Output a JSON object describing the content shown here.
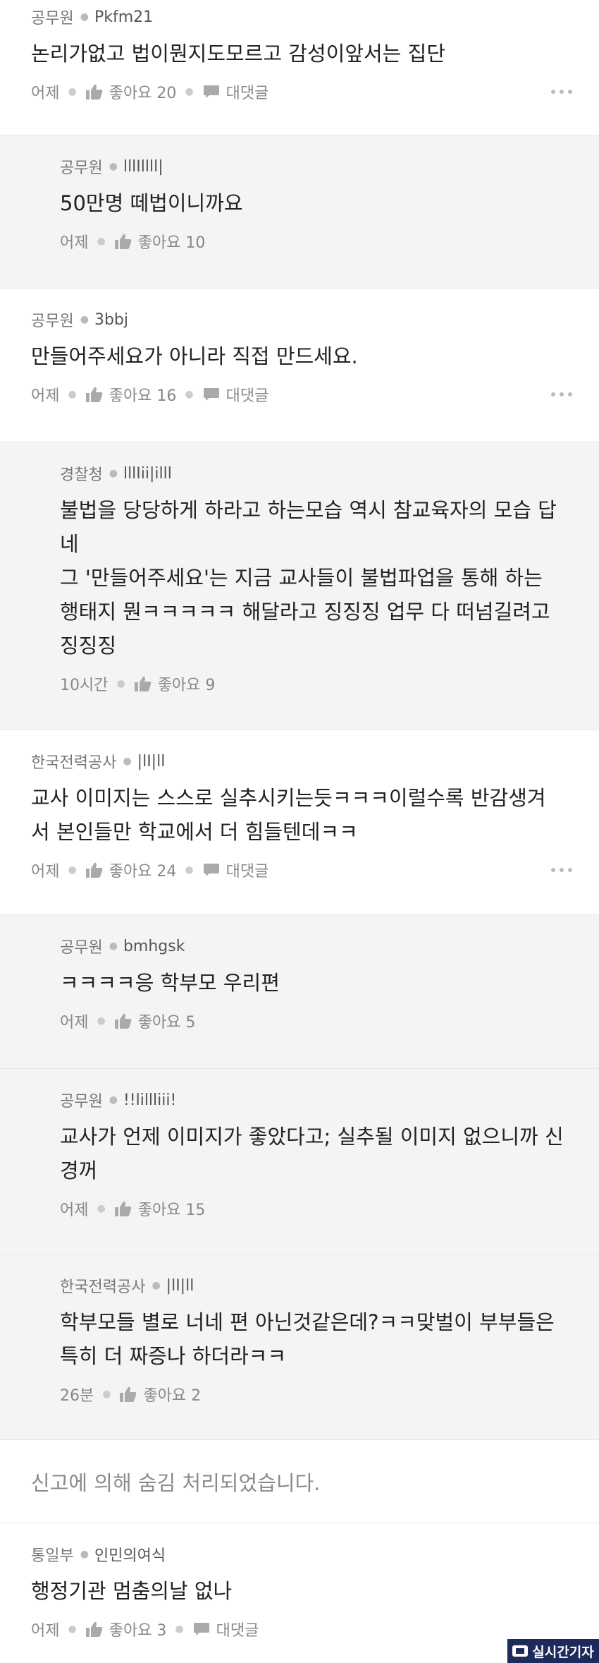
{
  "comments": [
    {
      "affiliation": "공무원",
      "user": "Pkfm21",
      "text": "논리가없고 법이뭔지도모르고 감성이앞서는 집단",
      "time": "어제",
      "likes": "좋아요 20",
      "reply_label": "대댓글"
    },
    {
      "affiliation": "공무원",
      "user": "lllIllll|",
      "text": "50만명 떼법이니까요",
      "time": "어제",
      "likes": "좋아요 10"
    },
    {
      "affiliation": "공무원",
      "user": "3bbj",
      "text": "만들어주세요가 아니라 직접 만드세요.",
      "time": "어제",
      "likes": "좋아요 16",
      "reply_label": "대댓글"
    },
    {
      "affiliation": "경찰청",
      "user": "lllIii|illl",
      "text": "불법을 당당하게 하라고 하는모습 역시 참교육자의 모습 답\n네\n그 '만들어주세요'는 지금 교사들이 불법파업을 통해 하는\n행태지 뭔ㅋㅋㅋㅋㅋ 해달라고 징징징 업무 다 떠넘길려고\n징징징",
      "time": "10시간",
      "likes": "좋아요 9"
    },
    {
      "affiliation": "한국전력공사",
      "user": "|lI|ll",
      "text": "교사 이미지는 스스로 실추시키는듯ㅋㅋㅋ이럴수록 반감생겨\n서 본인들만 학교에서 더 힘들텐데ㅋㅋ",
      "time": "어제",
      "likes": "좋아요 24",
      "reply_label": "대댓글"
    },
    {
      "affiliation": "공무원",
      "user": "bmhgsk",
      "text": "ㅋㅋㅋㅋ응 학부모 우리편",
      "time": "어제",
      "likes": "좋아요 5"
    },
    {
      "affiliation": "공무원",
      "user": "!!lillliii!",
      "text": "교사가 언제 이미지가 좋았다고; 실추될 이미지 없으니까 신\n경꺼",
      "time": "어제",
      "likes": "좋아요 15"
    },
    {
      "affiliation": "한국전력공사",
      "user": "|lI|ll",
      "text": "학부모들 별로 너네 편 아닌것같은데?ㅋㅋ맞벌이 부부들은\n특히 더 짜증나 하더라ㅋㅋ",
      "time": "26분",
      "likes": "좋아요 2"
    },
    {
      "affiliation": "통일부",
      "user": "인민의여식",
      "text": "행정기관 멈춤의날 없나",
      "time": "어제",
      "likes": "좋아요 3",
      "reply_label": "대댓글"
    }
  ],
  "hidden_notice": "신고에 의해 숨김 처리되었습니다.",
  "watermark": "실시간기자",
  "colors": {
    "reply_background": "#f4f4f4",
    "divider": "#e6e6e6",
    "watermark_background": "#1e2a5a"
  },
  "icons": {
    "like": "thumbs-up-icon",
    "reply": "speech-bubble-icon",
    "more": "more-dots-icon"
  }
}
